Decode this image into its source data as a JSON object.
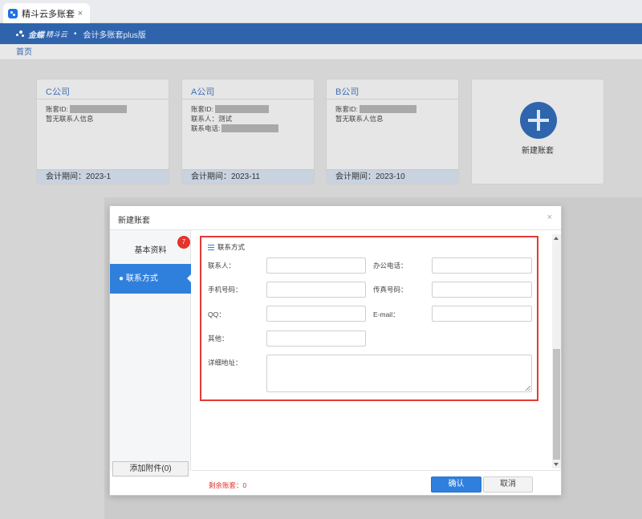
{
  "browser_tab": {
    "title": "精斗云多账套",
    "close_glyph": "×",
    "favicon": "jdy-app-icon"
  },
  "header": {
    "logo_text": "金蝶",
    "logo_sub": "精斗云",
    "separator": "•",
    "product": "会计多账套plus版"
  },
  "breadcrumb": {
    "home": "首页"
  },
  "cards": [
    {
      "name": "C公司",
      "lines": [
        {
          "label": "账套ID:",
          "masked": true
        },
        {
          "label": "暂无联系人信息",
          "masked": false
        }
      ],
      "period": "会计期间：2023-1"
    },
    {
      "name": "A公司",
      "lines": [
        {
          "label": "账套ID:",
          "masked": true
        },
        {
          "label": "联系人：测试",
          "masked": false
        },
        {
          "label": "联系电话:",
          "masked": true
        }
      ],
      "period": "会计期间：2023-11"
    },
    {
      "name": "B公司",
      "lines": [
        {
          "label": "账套ID:",
          "masked": true
        },
        {
          "label": "暂无联系人信息",
          "masked": false
        }
      ],
      "period": "会计期间：2023-10"
    }
  ],
  "new_card": {
    "label": "新建账套"
  },
  "dialog": {
    "title": "新建账套",
    "close_glyph": "×",
    "sidebar": {
      "basic": "基本资料",
      "contact": "● 联系方式",
      "badge": "7",
      "attach": "添加附件(0)"
    },
    "section_title": "联系方式",
    "fields": {
      "contact_person": {
        "label": "联系人：",
        "value": ""
      },
      "office_phone": {
        "label": "办公电话：",
        "value": ""
      },
      "mobile": {
        "label": "手机号码：",
        "value": ""
      },
      "fax": {
        "label": "传真号码：",
        "value": ""
      },
      "qq": {
        "label": "QQ：",
        "value": ""
      },
      "email": {
        "label": "E-mail：",
        "value": ""
      },
      "other": {
        "label": "其他：",
        "value": ""
      },
      "address": {
        "label": "详细地址：",
        "value": ""
      }
    },
    "footer": {
      "remaining": "剩余账套：0",
      "ok": "确认",
      "cancel": "取消"
    }
  },
  "colors": {
    "brand_blue": "#2f64ad",
    "accent_blue": "#2f80dc",
    "highlight_red": "#e33b35"
  }
}
